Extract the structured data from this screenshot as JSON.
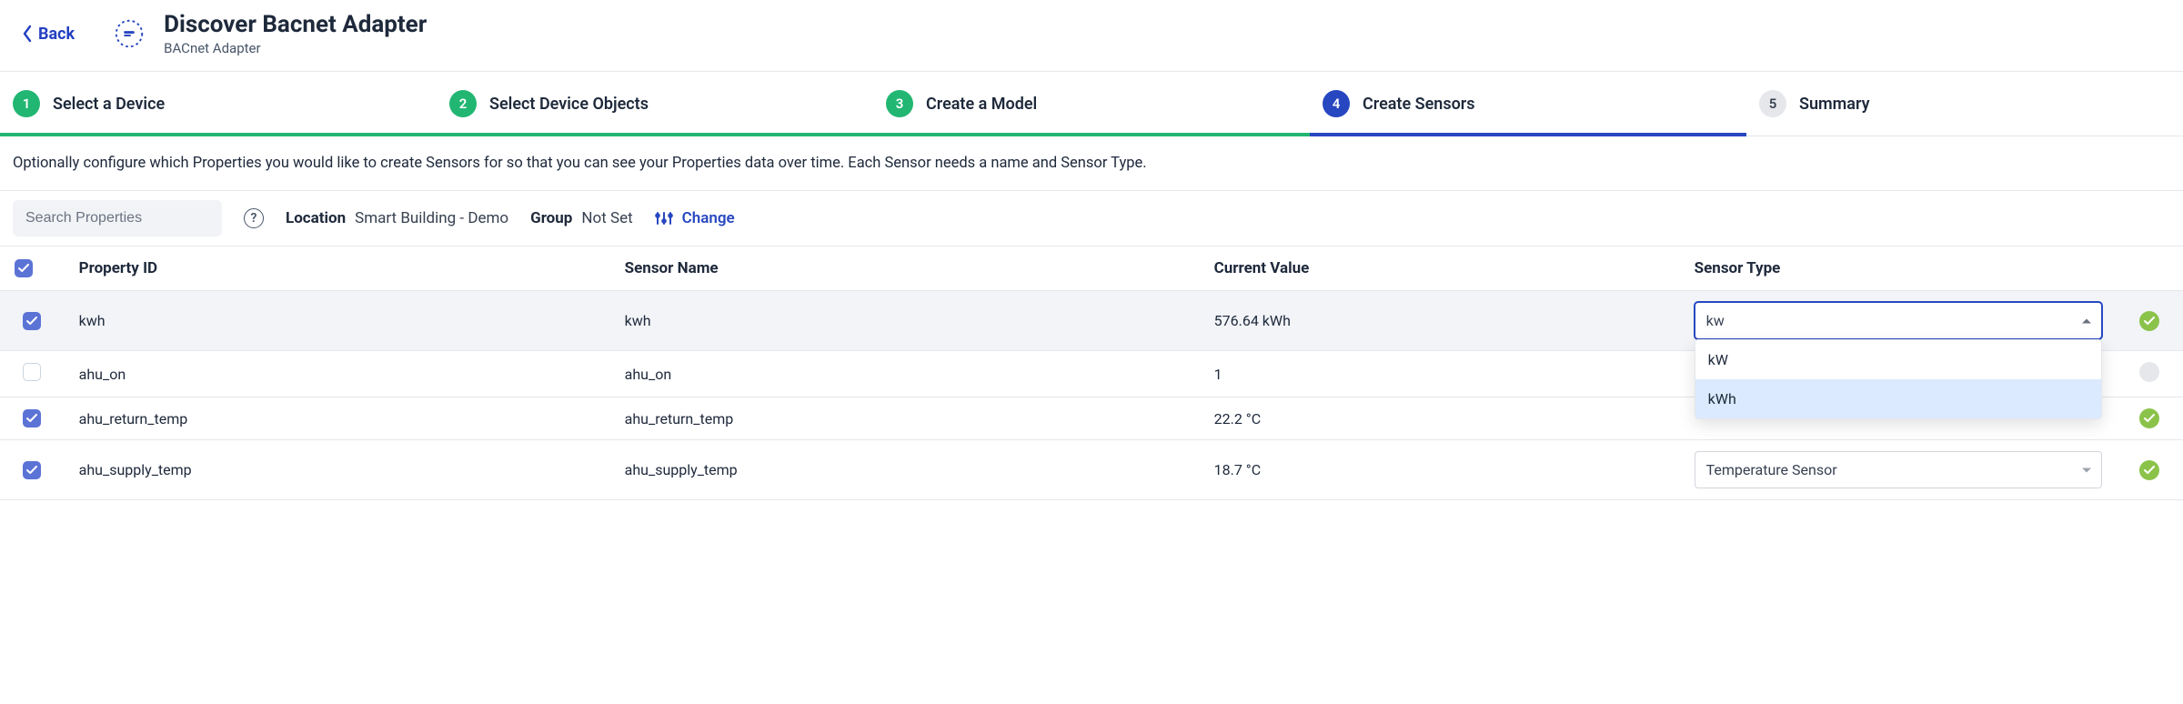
{
  "header": {
    "back_label": "Back",
    "title": "Discover Bacnet Adapter",
    "subtitle": "BACnet Adapter"
  },
  "stepper": {
    "steps": [
      {
        "num": "1",
        "label": "Select a Device",
        "state": "done"
      },
      {
        "num": "2",
        "label": "Select Device Objects",
        "state": "done"
      },
      {
        "num": "3",
        "label": "Create a Model",
        "state": "done"
      },
      {
        "num": "4",
        "label": "Create Sensors",
        "state": "current"
      },
      {
        "num": "5",
        "label": "Summary",
        "state": "pending"
      }
    ],
    "progress_done_pct": 60,
    "progress_current_pct": 20
  },
  "instruction": "Optionally configure which Properties you would like to create Sensors for so that you can see your Properties data over time. Each Sensor needs a name and Sensor Type.",
  "filter": {
    "search_placeholder": "Search Properties",
    "location_label": "Location",
    "location_value": "Smart Building - Demo",
    "group_label": "Group",
    "group_value": "Not Set",
    "change_label": "Change"
  },
  "table": {
    "headers": {
      "property_id": "Property ID",
      "sensor_name": "Sensor Name",
      "current_value": "Current Value",
      "sensor_type": "Sensor Type"
    },
    "rows": [
      {
        "checked": true,
        "property_id": "kwh",
        "sensor_name": "kwh",
        "current_value": "576.64 kWh",
        "sensor_type": "kw",
        "type_open": true,
        "status": "ok",
        "active": true
      },
      {
        "checked": false,
        "property_id": "ahu_on",
        "sensor_name": "ahu_on",
        "current_value": "1",
        "sensor_type": "",
        "type_open": false,
        "status": "off",
        "active": false,
        "hidden_select": true
      },
      {
        "checked": true,
        "property_id": "ahu_return_temp",
        "sensor_name": "ahu_return_temp",
        "current_value": "22.2 °C",
        "sensor_type": "",
        "type_open": false,
        "status": "ok",
        "active": false,
        "hidden_select": true
      },
      {
        "checked": true,
        "property_id": "ahu_supply_temp",
        "sensor_name": "ahu_supply_temp",
        "current_value": "18.7 °C",
        "sensor_type": "Temperature Sensor",
        "type_open": false,
        "status": "ok",
        "active": false
      }
    ],
    "dropdown_options": [
      "kW",
      "kWh"
    ],
    "dropdown_highlight_index": 1
  },
  "colors": {
    "accent_green": "#22b673",
    "accent_blue": "#2747c0",
    "status_ok": "#8bc34a"
  }
}
